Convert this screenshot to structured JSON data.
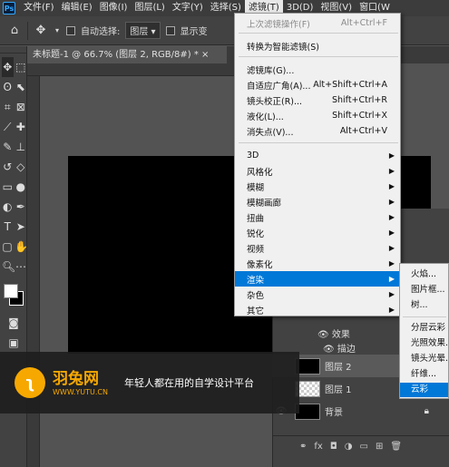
{
  "menubar": {
    "logo": "Ps",
    "items": [
      "文件(F)",
      "编辑(E)",
      "图像(I)",
      "图层(L)",
      "文字(Y)",
      "选择(S)",
      "滤镜(T)",
      "3D(D)",
      "视图(V)",
      "窗口(W"
    ]
  },
  "optbar": {
    "auto_select_label": "自动选择:",
    "auto_select_value": "图层",
    "show_transform_label": "显示变"
  },
  "tab": {
    "title": "未标题-1 @ 66.7% (图层 2, RGB/8#) *  ×"
  },
  "filter_menu": {
    "items": [
      {
        "label": "上次滤镜操作(F)",
        "shortcut": "Alt+Ctrl+F",
        "disabled": true
      },
      {
        "label": "转换为智能滤镜(S)",
        "shortcut": ""
      },
      {
        "label": "滤镜库(G)...",
        "shortcut": ""
      },
      {
        "label": "自适应广角(A)...",
        "shortcut": "Alt+Shift+Ctrl+A"
      },
      {
        "label": "镜头校正(R)...",
        "shortcut": "Shift+Ctrl+R"
      },
      {
        "label": "液化(L)...",
        "shortcut": "Shift+Ctrl+X"
      },
      {
        "label": "消失点(V)...",
        "shortcut": "Alt+Ctrl+V"
      },
      {
        "label": "3D"
      },
      {
        "label": "风格化"
      },
      {
        "label": "模糊"
      },
      {
        "label": "模糊画廊"
      },
      {
        "label": "扭曲"
      },
      {
        "label": "锐化"
      },
      {
        "label": "视频"
      },
      {
        "label": "像素化"
      },
      {
        "label": "渲染"
      },
      {
        "label": "杂色"
      },
      {
        "label": "其它"
      }
    ]
  },
  "render_submenu": {
    "items": [
      "火焰...",
      "图片框...",
      "树...",
      "分层云彩",
      "光照效果...",
      "镜头光晕...",
      "纤维...",
      "云彩"
    ]
  },
  "layers": {
    "effects_label": "效果",
    "stroke_label": "描边",
    "rows": [
      {
        "name": "图层 2"
      },
      {
        "name": "图层 1"
      },
      {
        "name": "背景"
      }
    ]
  },
  "banner": {
    "brand": "羽兔网",
    "url": "WWW.YUTU.CN",
    "slogan": "年轻人都在用的自学设计平台"
  },
  "colors": {
    "accent": "#0078d7",
    "brand": "#f6a800"
  }
}
